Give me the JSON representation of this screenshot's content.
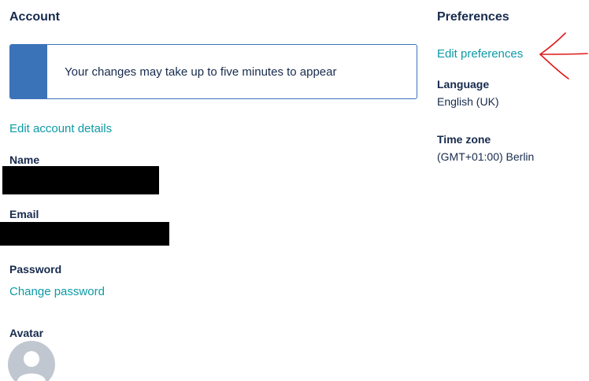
{
  "account": {
    "heading": "Account",
    "notice": "Your changes may take up to five minutes to appear",
    "edit_link": "Edit account details",
    "name_label": "Name",
    "email_label": "Email",
    "password_label": "Password",
    "change_password_link": "Change password",
    "avatar_label": "Avatar",
    "avatar_icon": "default-user-icon"
  },
  "preferences": {
    "heading": "Preferences",
    "edit_link": "Edit preferences",
    "language_label": "Language",
    "language_value": "English (UK)",
    "timezone_label": "Time zone",
    "timezone_value": "(GMT+01:00) Berlin"
  },
  "colors": {
    "link": "#0d9aa6",
    "notice_accent": "#3b73b9",
    "annotation": "#e01b1b"
  }
}
